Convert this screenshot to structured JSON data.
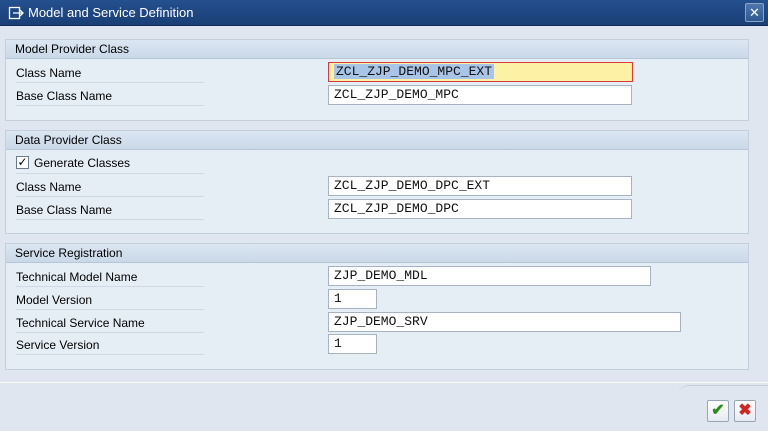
{
  "window": {
    "title": "Model and Service Definition",
    "close_glyph": "✕"
  },
  "model_provider": {
    "header": "Model Provider Class",
    "class_name_label": "Class Name",
    "class_name_value": "ZCL_ZJP_DEMO_MPC_EXT",
    "base_class_label": "Base Class Name",
    "base_class_value": "ZCL_ZJP_DEMO_MPC"
  },
  "data_provider": {
    "header": "Data Provider Class",
    "generate_label": "Generate Classes",
    "generate_checked": "✓",
    "class_name_label": "Class Name",
    "class_name_value": "ZCL_ZJP_DEMO_DPC_EXT",
    "base_class_label": "Base Class Name",
    "base_class_value": "ZCL_ZJP_DEMO_DPC"
  },
  "service_registration": {
    "header": "Service Registration",
    "tech_model_label": "Technical Model Name",
    "tech_model_value": "ZJP_DEMO_MDL",
    "model_version_label": "Model Version",
    "model_version_value": "1",
    "tech_service_label": "Technical Service Name",
    "tech_service_value": "ZJP_DEMO_SRV",
    "service_version_label": "Service Version",
    "service_version_value": "1"
  },
  "footer": {
    "ok_glyph": "✔",
    "cancel_glyph": "✖"
  },
  "colors": {
    "titlebar": "#1a3f76",
    "focus_field": "#fdf1a6",
    "ok_green": "#2e8b1e",
    "cancel_red": "#d3261f"
  },
  "icons": {
    "title": "window-exit-icon",
    "close": "close-icon",
    "ok": "checkmark-icon",
    "cancel": "cancel-icon"
  }
}
